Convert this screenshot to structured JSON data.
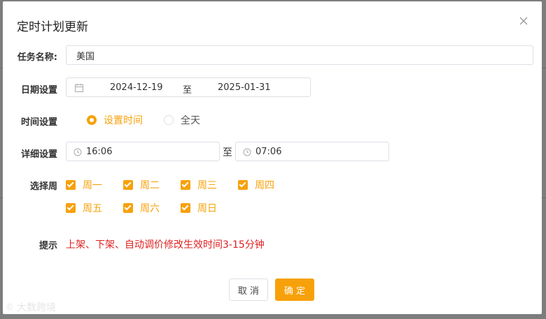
{
  "dialog": {
    "title": "定时计划更新",
    "close_icon": "close-icon"
  },
  "form": {
    "task_name": {
      "label": "任务名称:",
      "value": "美国"
    },
    "date": {
      "label": "日期设置",
      "start": "2024-12-19",
      "separator": "至",
      "end": "2025-01-31",
      "icon": "calendar-icon"
    },
    "time_mode": {
      "label": "时间设置",
      "options": [
        {
          "label": "设置时间",
          "checked": true
        },
        {
          "label": "全天",
          "checked": false
        }
      ]
    },
    "detail": {
      "label": "详细设置",
      "start": "16:06",
      "separator": "至",
      "end": "07:06",
      "icon": "clock-icon"
    },
    "weekdays": {
      "label": "选择周",
      "days": [
        "周一",
        "周二",
        "周三",
        "周四",
        "周五",
        "周六",
        "周日"
      ],
      "checked": [
        true,
        true,
        true,
        true,
        true,
        true,
        true
      ]
    },
    "tip": {
      "label": "提示",
      "text": "上架、下架、自动调价修改生效时间3-15分钟"
    }
  },
  "buttons": {
    "cancel": "取 消",
    "ok": "确 定"
  },
  "watermark": {
    "logo": "©",
    "text": "大数跨境"
  },
  "colors": {
    "accent": "#f7a10a",
    "danger": "#e02020"
  }
}
